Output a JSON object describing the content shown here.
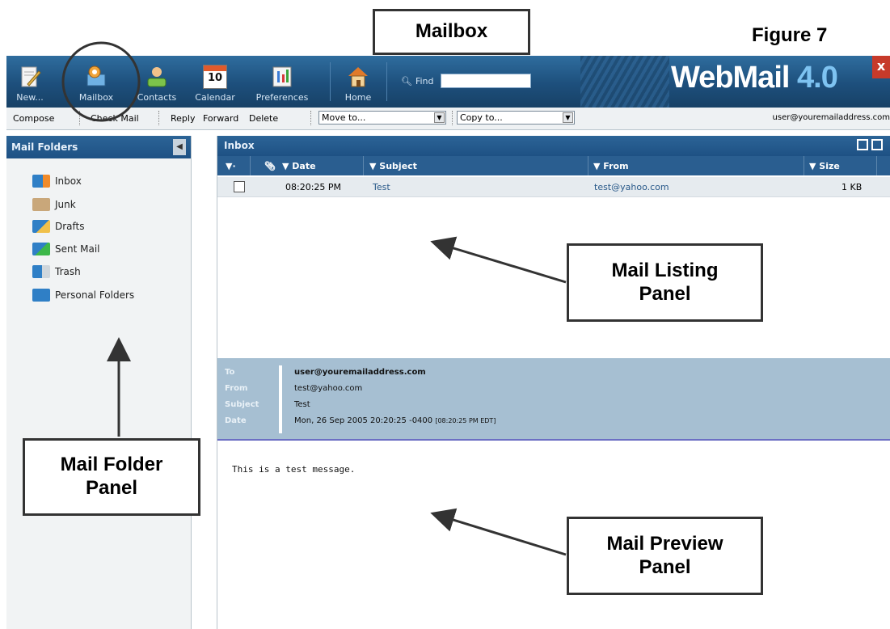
{
  "annotations": {
    "top_label": "Mailbox",
    "figure_label": "Figure 7",
    "listing_label": "Mail Listing\nPanel",
    "folder_label": "Mail Folder\nPanel",
    "preview_label": "Mail Preview\nPanel"
  },
  "toolbar": {
    "buttons": [
      {
        "label": "New...",
        "icon": "new-message-icon"
      },
      {
        "label": "Mailbox",
        "icon": "mailbox-icon"
      },
      {
        "label": "Contacts",
        "icon": "contacts-icon"
      },
      {
        "label": "Calendar",
        "icon": "calendar-icon"
      },
      {
        "label": "Preferences",
        "icon": "preferences-icon"
      },
      {
        "label": "Home",
        "icon": "home-icon"
      }
    ],
    "calendar_day": "10",
    "find_label": "Find",
    "find_value": "",
    "brand": "WebMail",
    "brand_version": "4.0",
    "close": "x"
  },
  "actions": {
    "compose": "Compose",
    "check_mail": "Check Mail",
    "reply": "Reply",
    "forward": "Forward",
    "delete": "Delete",
    "move_to": "Move to...",
    "copy_to": "Copy to...",
    "user": "user@youremailaddress.com"
  },
  "folders": {
    "title": "Mail Folders",
    "items": [
      "Inbox",
      "Junk",
      "Drafts",
      "Sent Mail",
      "Trash",
      "Personal Folders"
    ]
  },
  "listing": {
    "title": "Inbox",
    "columns": [
      "Date",
      "Subject",
      "From",
      "Size"
    ],
    "rows": [
      {
        "date": "08:20:25 PM",
        "subject": "Test",
        "from": "test@yahoo.com",
        "size": "1 KB"
      }
    ]
  },
  "preview": {
    "labels": {
      "to": "To",
      "from": "From",
      "subject": "Subject",
      "date": "Date"
    },
    "to": "user@youremailaddress.com",
    "from": "test@yahoo.com",
    "subject": "Test",
    "date": "Mon, 26 Sep 2005 20:20:25 -0400",
    "date_local": "[08:20:25 PM EDT]",
    "body": "This is a test message."
  },
  "colors": {
    "toolbar": "#1d4f7c",
    "panel_header": "#2c6497",
    "preview_header": "#a6bfd2",
    "row_highlight": "#e6ebef"
  }
}
